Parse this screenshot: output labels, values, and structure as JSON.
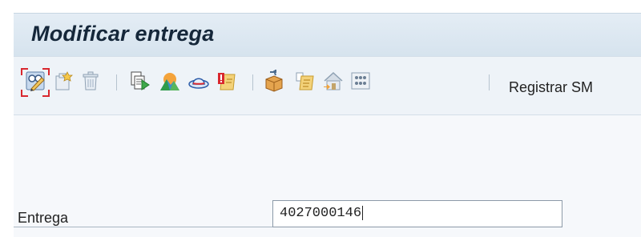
{
  "window": {
    "title": "Modificar entrega"
  },
  "toolbar": {
    "buttons": [
      {
        "icon": "display-change-icon",
        "focused": true
      },
      {
        "icon": "create-document-icon"
      },
      {
        "icon": "delete-trash-icon"
      },
      {
        "icon": "copy-document-icon"
      },
      {
        "icon": "mountain-overview-icon"
      },
      {
        "icon": "hat-partner-icon"
      },
      {
        "icon": "warning-document-icon"
      },
      {
        "icon": "package-icon"
      },
      {
        "icon": "packing-list-icon"
      },
      {
        "icon": "house-warehouse-icon"
      },
      {
        "icon": "grid-items-icon"
      }
    ],
    "post_goods_issue_label": "Registrar SM"
  },
  "form": {
    "delivery_label": "Entrega",
    "delivery_value": "4027000146"
  },
  "colors": {
    "title_bar": "#d6e3ee",
    "toolbar": "#eef3f8",
    "focus_border": "#d9282f"
  }
}
